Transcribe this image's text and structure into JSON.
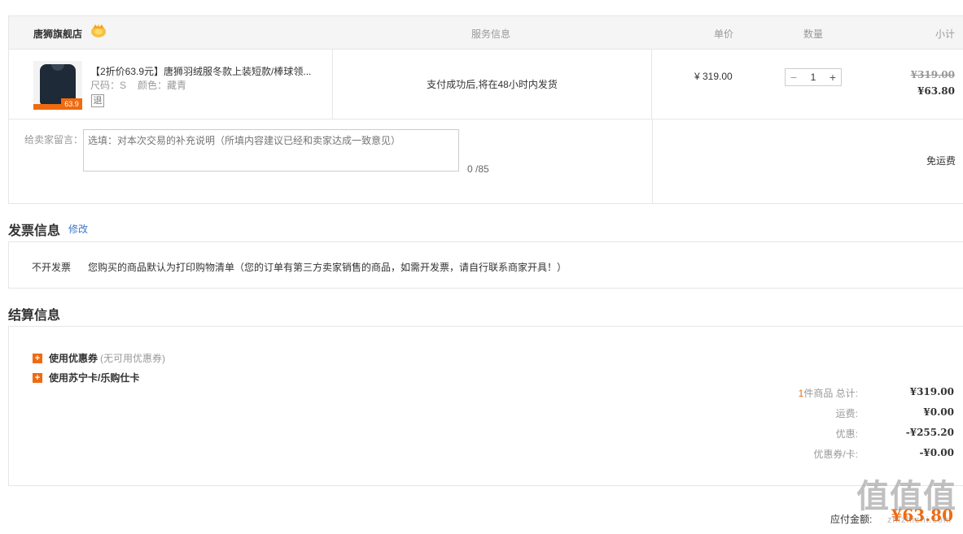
{
  "order": {
    "shop_name": "唐狮旗舰店",
    "columns": {
      "service": "服务信息",
      "unit_price": "单价",
      "quantity": "数量",
      "subtotal": "小计"
    },
    "product": {
      "title": "【2折价63.9元】唐狮羽绒服冬款上装短款/棒球领...",
      "size": "尺码：S",
      "color": "颜色：藏青",
      "return_badge": "退",
      "thumb_tag": "63.9",
      "service_text": "支付成功后,将在48小时内发货",
      "unit_price": "¥ 319.00",
      "quantity": "1",
      "qty_minus": "−",
      "qty_plus": "+",
      "subtotal_original": "¥319.00",
      "subtotal": "¥63.80"
    },
    "message": {
      "label": "给卖家留言：",
      "placeholder": "选填：对本次交易的补充说明（所填内容建议已经和卖家达成一致意见）",
      "counter": "0 /85"
    },
    "shipping": "免运费"
  },
  "invoice": {
    "title": "发票信息",
    "edit_label": "修改",
    "type": "不开发票",
    "note": "您购买的商品默认为打印购物清单（您的订单有第三方卖家销售的商品，如需开发票，请自行联系商家开具！）"
  },
  "settlement": {
    "title": "结算信息",
    "options": [
      {
        "icon": "+",
        "label": "使用优惠券",
        "hint": "(无可用优惠券)"
      },
      {
        "icon": "+",
        "label": "使用苏宁卡/乐购仕卡",
        "hint": ""
      }
    ],
    "summary": {
      "item_count": "1",
      "total_label": "件商品 总计:",
      "total_value": "¥319.00",
      "freight_label": "运费:",
      "freight_value": "¥0.00",
      "discount_label": "优惠:",
      "discount_value": "-¥255.20",
      "coupon_label": "优惠券/卡:",
      "coupon_value": "-¥0.00"
    },
    "payable_label": "应付金额:",
    "payable_value": "¥63.80"
  },
  "watermark": {
    "main": "值值值",
    "sub": "zhizhizhi.com"
  },
  "colors": {
    "accent": "#f06a10",
    "link": "#3c78c8",
    "border": "#e6e6e6",
    "header_bg": "#f5f5f5"
  }
}
